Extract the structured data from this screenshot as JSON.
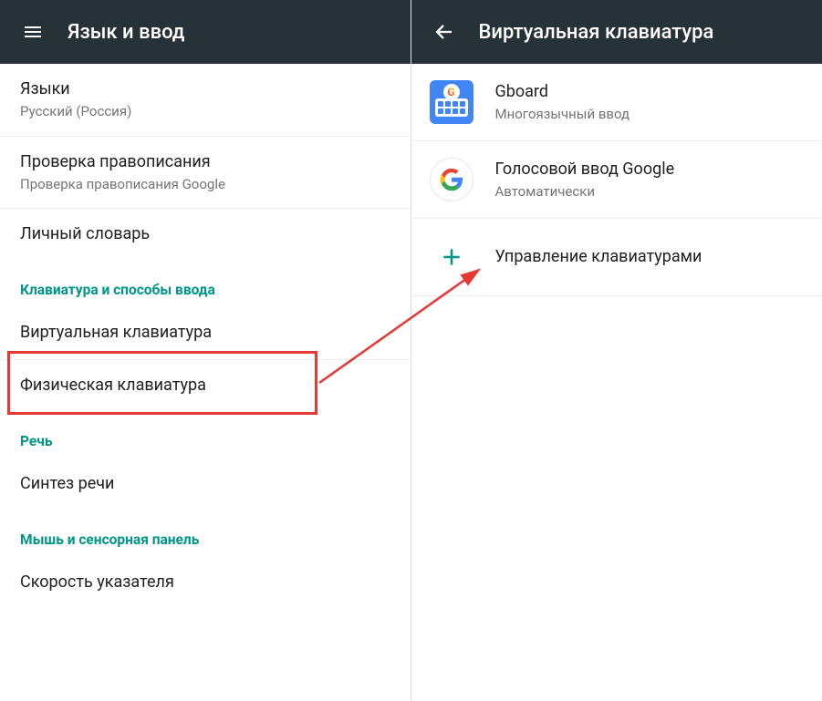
{
  "left": {
    "title": "Язык и ввод",
    "items": {
      "languages": {
        "primary": "Языки",
        "secondary": "Русский (Россия)"
      },
      "spellcheck": {
        "primary": "Проверка правописания",
        "secondary": "Проверка правописания Google"
      },
      "personal_dict": {
        "primary": "Личный словарь"
      }
    },
    "sections": {
      "keyboard_methods": "Клавиатура и способы ввода",
      "speech": "Речь",
      "mouse": "Мышь и сенсорная панель"
    },
    "virtual_kbd": {
      "primary": "Виртуальная клавиатура"
    },
    "physical_kbd": {
      "primary": "Физическая клавиатура"
    },
    "tts": {
      "primary": "Синтез речи"
    },
    "pointer_speed": {
      "primary": "Скорость указателя"
    }
  },
  "right": {
    "title": "Виртуальная клавиатура",
    "gboard": {
      "primary": "Gboard",
      "secondary": "Многоязычный ввод"
    },
    "google_voice": {
      "primary": "Голосовой ввод Google",
      "secondary": "Автоматически"
    },
    "manage": {
      "primary": "Управление клавиатурами"
    }
  }
}
